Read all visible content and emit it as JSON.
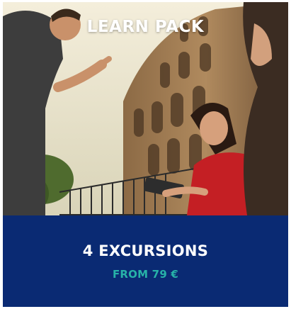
{
  "card": {
    "title": "LEARN PACK",
    "headline": "4 EXCURSIONS",
    "price_text": "FROM 79 €"
  },
  "colors": {
    "panel_background": "#0a2a73",
    "headline_text": "#ffffff",
    "price_text": "#27b2a8"
  },
  "image": {
    "subject": "tourists-at-colosseum-photo"
  }
}
